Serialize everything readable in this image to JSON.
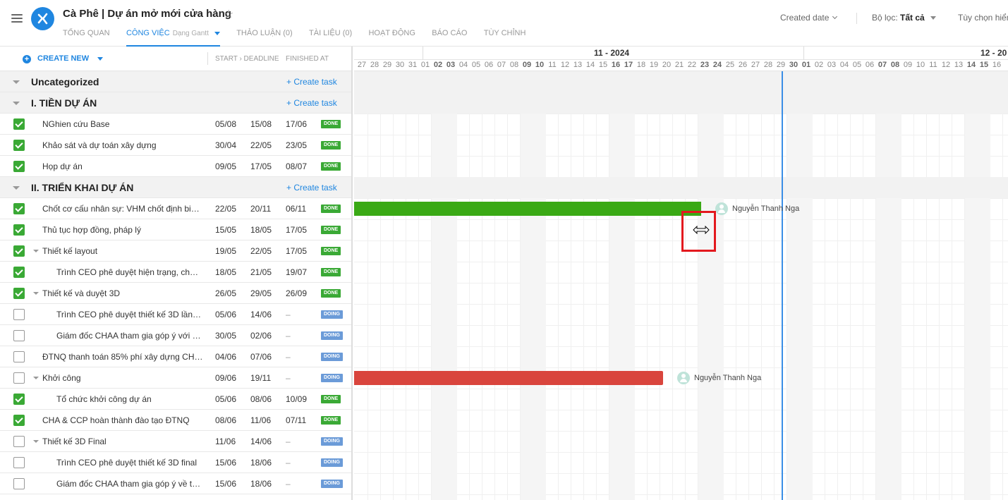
{
  "header": {
    "title": "Cà Phê | Dự án mở mới cửa hàng",
    "tabs": [
      {
        "label": "TỔNG QUAN"
      },
      {
        "label": "CÔNG VIỆC",
        "sub": "Dạng Gantt"
      },
      {
        "label": "THẢO LUẬN (0)"
      },
      {
        "label": "TÀI LIỆU (0)"
      },
      {
        "label": "HOẠT ĐỘNG"
      },
      {
        "label": "BÁO CÁO"
      },
      {
        "label": "TÙY CHỈNH"
      }
    ],
    "sort_label": "Created date",
    "filter_label": "Bộ lọc:",
    "filter_value": "Tất cả",
    "options_label": "Tùy chọn hiển"
  },
  "toolbar": {
    "create_new": "CREATE NEW",
    "col_start_deadline": "START › DEADLINE",
    "col_finished": "FINISHED AT"
  },
  "groups": {
    "uncategorized": {
      "name": "Uncategorized",
      "create": "+ Create task"
    },
    "g1": {
      "name": "I. TIỀN DỰ ÁN",
      "create": "+ Create task"
    },
    "g2": {
      "name": "II. TRIỂN KHAI DỰ ÁN",
      "create": "+ Create task"
    }
  },
  "tasks": [
    {
      "name": "NGhien cứu Base",
      "start": "05/08",
      "deadline": "15/08",
      "finished": "17/06",
      "status": "DONE",
      "checked": true
    },
    {
      "name": "Khảo sát và dự toán xây dựng",
      "start": "30/04",
      "deadline": "22/05",
      "finished": "23/05",
      "status": "DONE",
      "checked": true
    },
    {
      "name": "Họp dự án",
      "start": "09/05",
      "deadline": "17/05",
      "finished": "08/07",
      "status": "DONE",
      "checked": true
    },
    {
      "name": "Chốt cơ cấu nhân sự: VHM chốt định biên...",
      "start": "22/05",
      "deadline": "20/11",
      "finished": "06/11",
      "status": "DONE",
      "checked": true
    },
    {
      "name": "Thủ tục hợp đồng, pháp lý",
      "start": "15/05",
      "deadline": "18/05",
      "finished": "17/05",
      "status": "DONE",
      "checked": true
    },
    {
      "name": "Thiết kế layout",
      "start": "19/05",
      "deadline": "22/05",
      "finished": "17/05",
      "status": "DONE",
      "checked": true
    },
    {
      "name": "Trình CEO phê duyệt hiện trạng, chủ đầu tư...",
      "start": "18/05",
      "deadline": "21/05",
      "finished": "19/07",
      "status": "DONE",
      "checked": true
    },
    {
      "name": "Thiết kế và duyệt 3D",
      "start": "26/05",
      "deadline": "29/05",
      "finished": "26/09",
      "status": "DONE",
      "checked": true
    },
    {
      "name": "Trình CEO phê duyệt thiết kế 3D lần 1...",
      "start": "05/06",
      "deadline": "14/06",
      "finished": "–",
      "status": "DOING",
      "checked": false
    },
    {
      "name": "Giám đốc CHAA tham gia góp ý với c...",
      "start": "30/05",
      "deadline": "02/06",
      "finished": "–",
      "status": "DOING",
      "checked": false
    },
    {
      "name": "ĐTNQ thanh toán 85% phí xây dựng CHAA...",
      "start": "04/06",
      "deadline": "07/06",
      "finished": "–",
      "status": "DOING",
      "checked": false
    },
    {
      "name": "Khởi công",
      "start": "09/06",
      "deadline": "19/11",
      "finished": "–",
      "status": "DOING",
      "checked": false
    },
    {
      "name": "Tổ chức khởi công dự án",
      "start": "05/06",
      "deadline": "08/06",
      "finished": "10/09",
      "status": "DONE",
      "checked": true
    },
    {
      "name": "CHA & CCP hoàn thành đào tạo ĐTNQ",
      "start": "08/06",
      "deadline": "11/06",
      "finished": "07/11",
      "status": "DONE",
      "checked": true
    },
    {
      "name": "Thiết kế 3D Final",
      "start": "11/06",
      "deadline": "14/06",
      "finished": "–",
      "status": "DOING",
      "checked": false
    },
    {
      "name": "Trình CEO phê duyệt thiết kế 3D final",
      "start": "15/06",
      "deadline": "18/06",
      "finished": "–",
      "status": "DOING",
      "checked": false
    },
    {
      "name": "Giám đốc CHAA tham gia góp ý về th...",
      "start": "15/06",
      "deadline": "18/06",
      "finished": "–",
      "status": "DOING",
      "checked": false
    }
  ],
  "gantt": {
    "months": [
      "11 - 2024",
      "12 - 20"
    ],
    "days": [
      "27",
      "28",
      "29",
      "30",
      "31",
      "01",
      "02",
      "03",
      "04",
      "05",
      "06",
      "07",
      "08",
      "09",
      "10",
      "11",
      "12",
      "13",
      "14",
      "15",
      "16",
      "17",
      "18",
      "19",
      "20",
      "21",
      "22",
      "23",
      "24",
      "25",
      "26",
      "27",
      "28",
      "29",
      "30",
      "01",
      "02",
      "03",
      "04",
      "05",
      "06",
      "07",
      "08",
      "09",
      "10",
      "11",
      "12",
      "13",
      "14",
      "15",
      "16"
    ],
    "assignee_1": "Nguyễn Thanh Nga",
    "assignee_2": "Nguyễn Thanh Nga"
  },
  "colors": {
    "accent": "#1f86e0",
    "done": "#3aa935",
    "doing": "#6b9bd8",
    "bar_green": "#3aa915",
    "bar_red": "#d9453d",
    "today_line": "#3a8ee6"
  },
  "icons": [
    "menu-icon",
    "app-logo-icon",
    "star-icon",
    "plus-circle-icon",
    "resize-cursor-icon"
  ]
}
